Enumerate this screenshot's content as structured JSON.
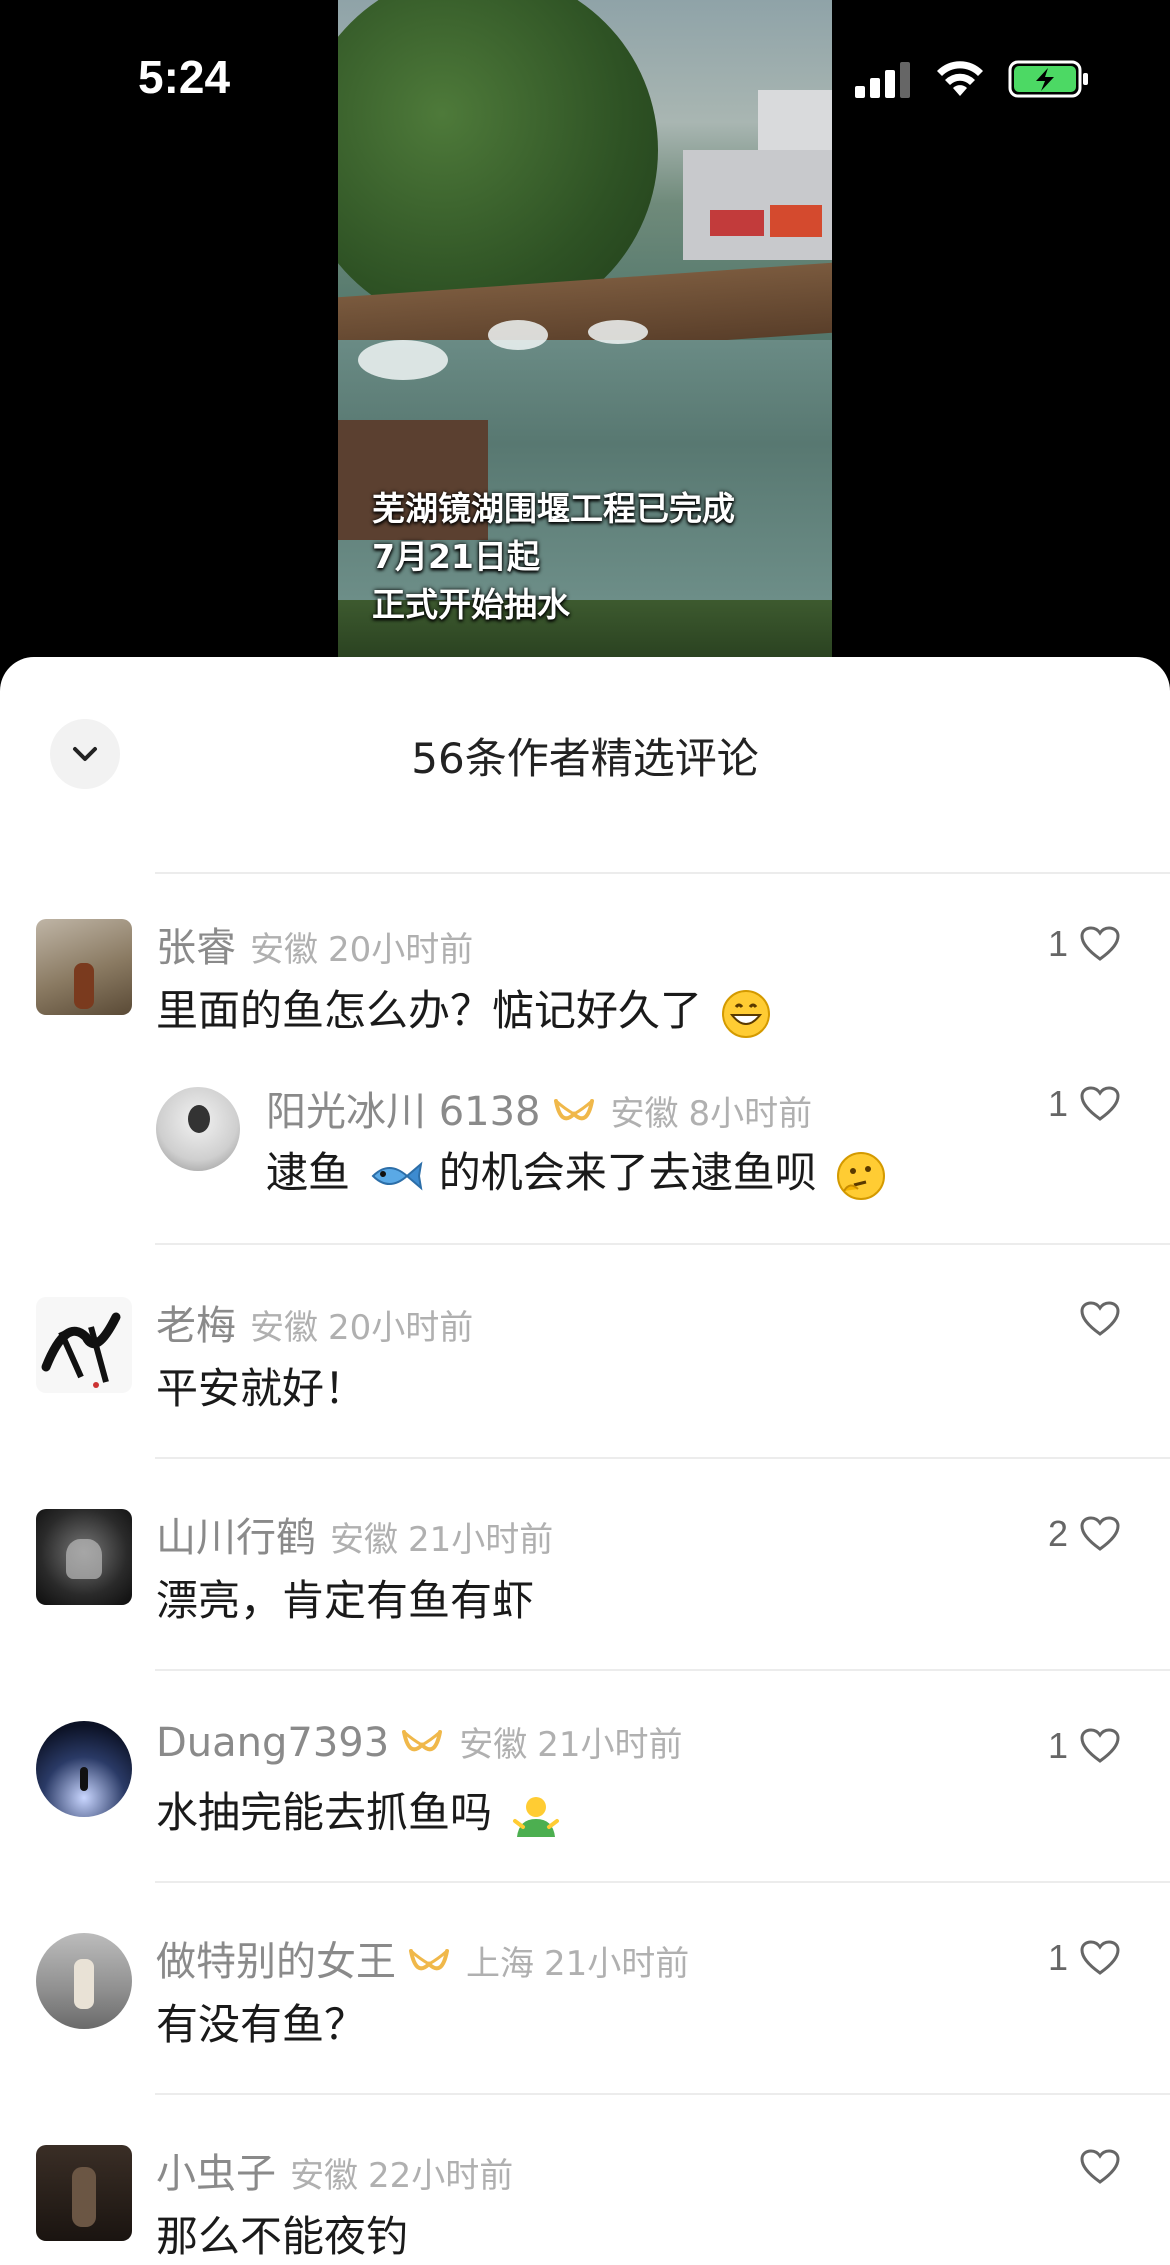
{
  "status_bar": {
    "time": "5:24"
  },
  "video": {
    "caption_lines": [
      "芜湖镜湖围堰工程已完成",
      "7月21日起",
      "正式开始抽水"
    ]
  },
  "sheet": {
    "title": "56条作者精选评论"
  },
  "comments": [
    {
      "user": "张睿",
      "location": "安徽",
      "time": "20小时前",
      "text": "里面的鱼怎么办？惦记好久了",
      "likes": "1",
      "emoji": "grinning-face-emoji"
    },
    {
      "user": "阳光冰川 6138",
      "location": "安徽",
      "time": "8小时前",
      "text_parts": [
        "逮鱼",
        "的机会来了去逮鱼呗"
      ],
      "likes": "1",
      "reply": true
    },
    {
      "user": "老梅",
      "location": "安徽",
      "time": "20小时前",
      "text": "平安就好！",
      "likes": ""
    },
    {
      "user": "山川行鹤",
      "location": "安徽",
      "time": "21小时前",
      "text": "漂亮，肯定有鱼有虾",
      "likes": "2"
    },
    {
      "user": "Duang7393",
      "location": "安徽",
      "time": "21小时前",
      "text": "水抽完能去抓鱼吗",
      "likes": "1"
    },
    {
      "user": "做特别的女王",
      "location": "上海",
      "time": "21小时前",
      "text": "有没有鱼？",
      "likes": "1"
    },
    {
      "user": "小虫子",
      "location": "安徽",
      "time": "22小时前",
      "text": "那么不能夜钓",
      "likes": ""
    }
  ],
  "colors": {
    "accent_badge": "#f0b84a",
    "heart_outline": "#666666"
  }
}
